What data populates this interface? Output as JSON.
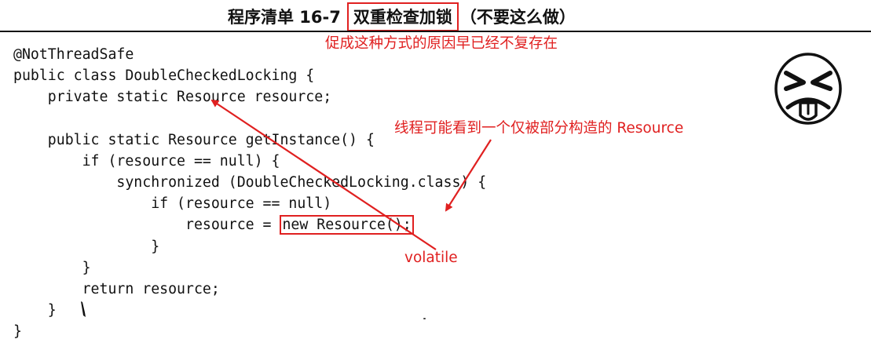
{
  "listing": {
    "number": "程序清单 16-7",
    "title_boxed": "双重检查加锁",
    "title_suffix": "（不要这么做）"
  },
  "code": {
    "lines": [
      {
        "text": "@NotThreadSafe"
      },
      {
        "text": "public class DoubleCheckedLocking {"
      },
      {
        "text": "    private static Resource resource;"
      },
      {
        "text": ""
      },
      {
        "text": "    public static Resource getInstance() {"
      },
      {
        "text": "        if (resource == null) {"
      },
      {
        "text": "            synchronized (DoubleCheckedLocking.class) {"
      },
      {
        "text": "                if (resource == null)"
      },
      {
        "pre": "                    resource = ",
        "boxed": "new Resource();"
      },
      {
        "text": "                }"
      },
      {
        "text": "        }"
      },
      {
        "text": "        return resource;"
      },
      {
        "text": "    }"
      },
      {
        "text": "}"
      }
    ]
  },
  "annotations": {
    "top_note": "促成这种方式的原因早已经不复存在",
    "partial_note": "线程可能看到一个仅被部分构造的 Resource",
    "volatile_note": "volatile",
    "color": "#e02020"
  },
  "face_icon": "angry-face-icon"
}
